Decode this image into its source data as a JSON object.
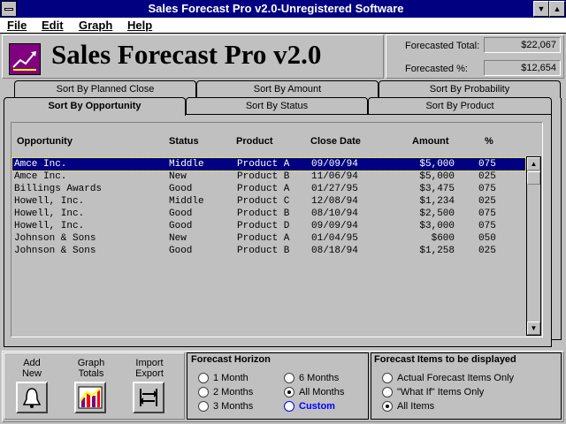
{
  "window": {
    "title": "Sales Forecast Pro v2.0-Unregistered Software"
  },
  "menu": [
    "File",
    "Edit",
    "Graph",
    "Help"
  ],
  "header": {
    "app_title": "Sales Forecast Pro v2.0",
    "forecasted_total_label": "Forecasted Total:",
    "forecasted_total_value": "$22,067",
    "forecasted_pct_label": "Forecasted %:",
    "forecasted_pct_value": "$12,654"
  },
  "tabs_back": [
    "Sort By Planned Close",
    "Sort By Amount",
    "Sort By Probability"
  ],
  "tabs_front": [
    "Sort By Opportunity",
    "Sort By Status",
    "Sort By Product"
  ],
  "table": {
    "columns": [
      "Opportunity",
      "Status",
      "Product",
      "Close Date",
      "Amount",
      "%"
    ],
    "rows": [
      [
        "Amce Inc.",
        "Middle",
        "Product A",
        "09/09/94",
        "$5,000",
        "075"
      ],
      [
        "Amce Inc.",
        "New",
        "Product B",
        "11/06/94",
        "$5,000",
        "025"
      ],
      [
        "Billings Awards",
        "Good",
        "Product A",
        "01/27/95",
        "$3,475",
        "075"
      ],
      [
        "Howell, Inc.",
        "Middle",
        "Product C",
        "12/08/94",
        "$1,234",
        "025"
      ],
      [
        "Howell, Inc.",
        "Good",
        "Product B",
        "08/10/94",
        "$2,500",
        "075"
      ],
      [
        "Howell, Inc.",
        "Good",
        "Product D",
        "09/09/94",
        "$3,000",
        "075"
      ],
      [
        "Johnson & Sons",
        "New",
        "Product A",
        "01/04/95",
        "$600",
        "050"
      ],
      [
        "Johnson & Sons",
        "Good",
        "Product B",
        "08/18/94",
        "$1,258",
        "025"
      ]
    ],
    "selected_index": 0
  },
  "toolbar": {
    "add_new": [
      "Add",
      "New"
    ],
    "graph_totals": [
      "Graph",
      "Totals"
    ],
    "import_export": [
      "Import",
      "Export"
    ]
  },
  "forecast_horizon": {
    "title": "Forecast Horizon",
    "options": [
      "1 Month",
      "2 Months",
      "3 Months",
      "6 Months",
      "All Months",
      "Custom"
    ],
    "selected": "All Months"
  },
  "forecast_items": {
    "title": "Forecast Items to be displayed",
    "options": [
      "Actual Forecast Items Only",
      "\"What If\" Items Only",
      "All Items"
    ],
    "selected": "All Items"
  },
  "colors": {
    "titlebar": "#000080",
    "selection": "#000080",
    "custom_link": "#0000ff",
    "logo": "#800080"
  }
}
